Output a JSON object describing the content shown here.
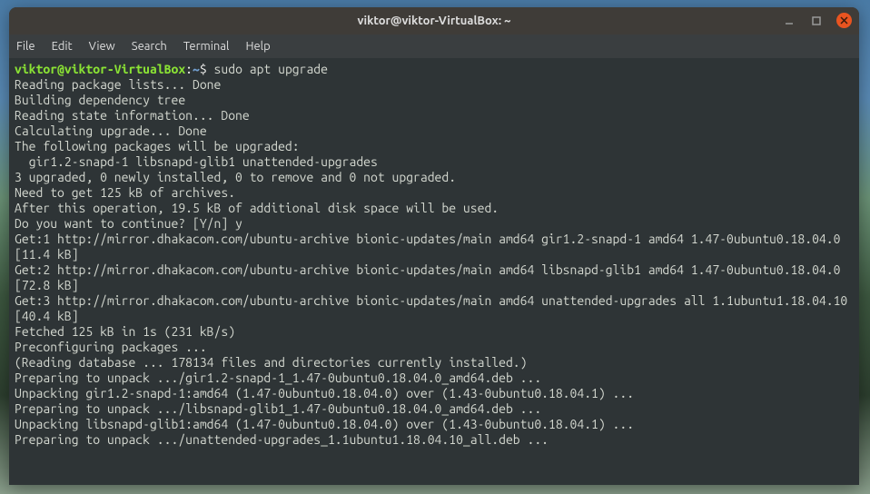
{
  "titlebar": {
    "title": "viktor@viktor-VirtualBox: ~"
  },
  "menubar": {
    "items": [
      "File",
      "Edit",
      "View",
      "Search",
      "Terminal",
      "Help"
    ]
  },
  "prompt": {
    "user_host": "viktor@viktor-VirtualBox",
    "colon": ":",
    "path": "~",
    "symbol": "$",
    "command": "sudo apt upgrade"
  },
  "output": [
    "Reading package lists... Done",
    "Building dependency tree",
    "Reading state information... Done",
    "Calculating upgrade... Done",
    "The following packages will be upgraded:",
    "  gir1.2-snapd-1 libsnapd-glib1 unattended-upgrades",
    "3 upgraded, 0 newly installed, 0 to remove and 0 not upgraded.",
    "Need to get 125 kB of archives.",
    "After this operation, 19.5 kB of additional disk space will be used.",
    "Do you want to continue? [Y/n] y",
    "Get:1 http://mirror.dhakacom.com/ubuntu-archive bionic-updates/main amd64 gir1.2-snapd-1 amd64 1.47-0ubuntu0.18.04.0 [11.4 kB]",
    "Get:2 http://mirror.dhakacom.com/ubuntu-archive bionic-updates/main amd64 libsnapd-glib1 amd64 1.47-0ubuntu0.18.04.0 [72.8 kB]",
    "Get:3 http://mirror.dhakacom.com/ubuntu-archive bionic-updates/main amd64 unattended-upgrades all 1.1ubuntu1.18.04.10 [40.4 kB]",
    "Fetched 125 kB in 1s (231 kB/s)",
    "Preconfiguring packages ...",
    "(Reading database ... 178134 files and directories currently installed.)",
    "Preparing to unpack .../gir1.2-snapd-1_1.47-0ubuntu0.18.04.0_amd64.deb ...",
    "Unpacking gir1.2-snapd-1:amd64 (1.47-0ubuntu0.18.04.0) over (1.43-0ubuntu0.18.04.1) ...",
    "Preparing to unpack .../libsnapd-glib1_1.47-0ubuntu0.18.04.0_amd64.deb ...",
    "Unpacking libsnapd-glib1:amd64 (1.47-0ubuntu0.18.04.0) over (1.43-0ubuntu0.18.04.1) ...",
    "Preparing to unpack .../unattended-upgrades_1.1ubuntu1.18.04.10_all.deb ..."
  ]
}
